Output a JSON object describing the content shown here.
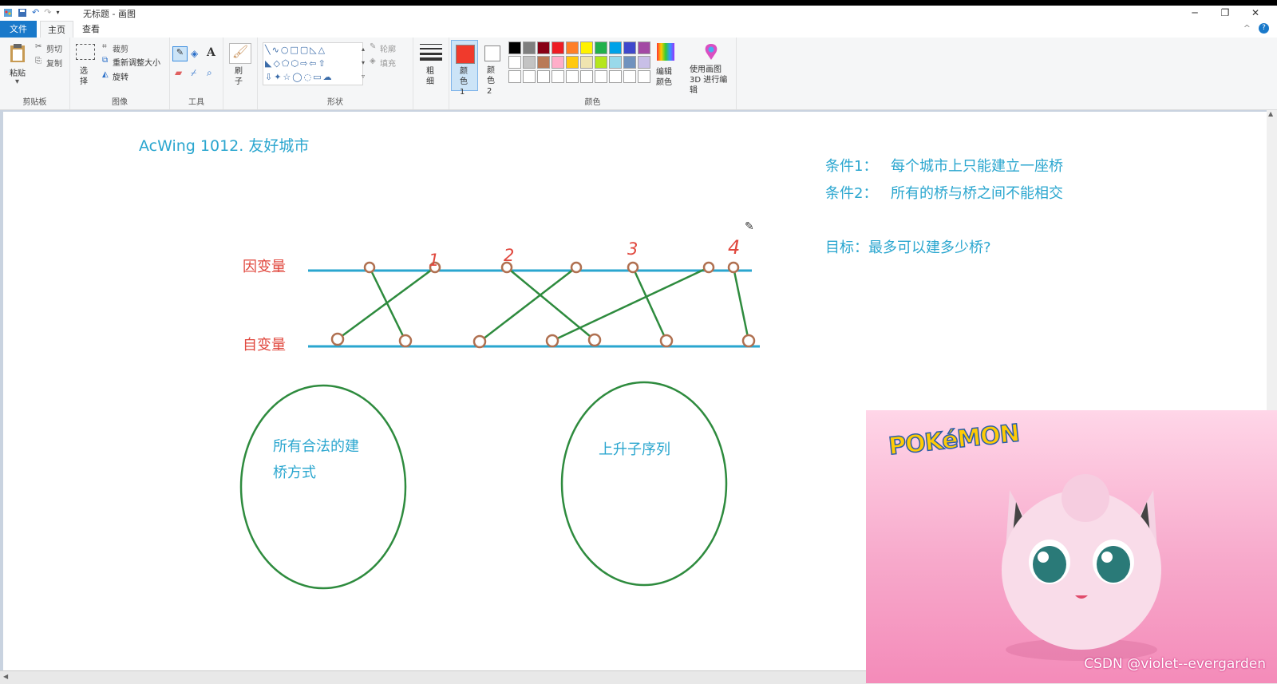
{
  "window": {
    "title": "无标题 - 画图",
    "controls": [
      "─",
      "❐",
      "✕"
    ]
  },
  "tabs": {
    "file": "文件",
    "home": "主页",
    "view": "查看"
  },
  "ribbon": {
    "clipboard": {
      "paste": "粘贴",
      "cut": "剪切",
      "copy": "复制",
      "label": "剪贴板"
    },
    "image": {
      "select": "选择",
      "crop": "裁剪",
      "resize": "重新调整大小",
      "rotate": "旋转",
      "label": "图像"
    },
    "tools": {
      "label": "工具"
    },
    "brush": {
      "label": "刷子"
    },
    "shapes": {
      "outline": "轮廓",
      "fill": "填充",
      "label": "形状"
    },
    "size": {
      "label": "粗细"
    },
    "colors": {
      "color1": "颜色 1",
      "color2": "颜色 2",
      "edit": "编辑颜色",
      "label": "颜色",
      "color1_value": "#f03a2c",
      "palette_row1": [
        "#000000",
        "#7f7f7f",
        "#880015",
        "#ed1c24",
        "#ff7f27",
        "#fff200",
        "#22b14c",
        "#00a2e8",
        "#3f48cc",
        "#a349a4"
      ],
      "palette_row2": [
        "#ffffff",
        "#c3c3c3",
        "#b97a57",
        "#ffaec9",
        "#ffc90e",
        "#efe4b0",
        "#b5e61d",
        "#99d9ea",
        "#7092be",
        "#c8bfe7"
      ]
    },
    "paint3d": "使用画图 3D 进行编辑"
  },
  "canvas": {
    "title": "AcWing 1012. 友好城市",
    "condition1_label": "条件1：",
    "condition1_text": "每个城市上只能建立一座桥",
    "condition2_label": "条件2：",
    "condition2_text": "所有的桥与桥之间不能相交",
    "goal": "目标：最多可以建多少桥?",
    "dependent": "因变量",
    "independent": "自变量",
    "numbers": [
      "1",
      "2",
      "3",
      "4"
    ],
    "ellipse_left_line1": "所有合法的建",
    "ellipse_left_line2": "桥方式",
    "ellipse_right": "上升子序列"
  },
  "overlay": {
    "logo": "POKéMON",
    "watermark": "CSDN @violet--evergarden"
  }
}
